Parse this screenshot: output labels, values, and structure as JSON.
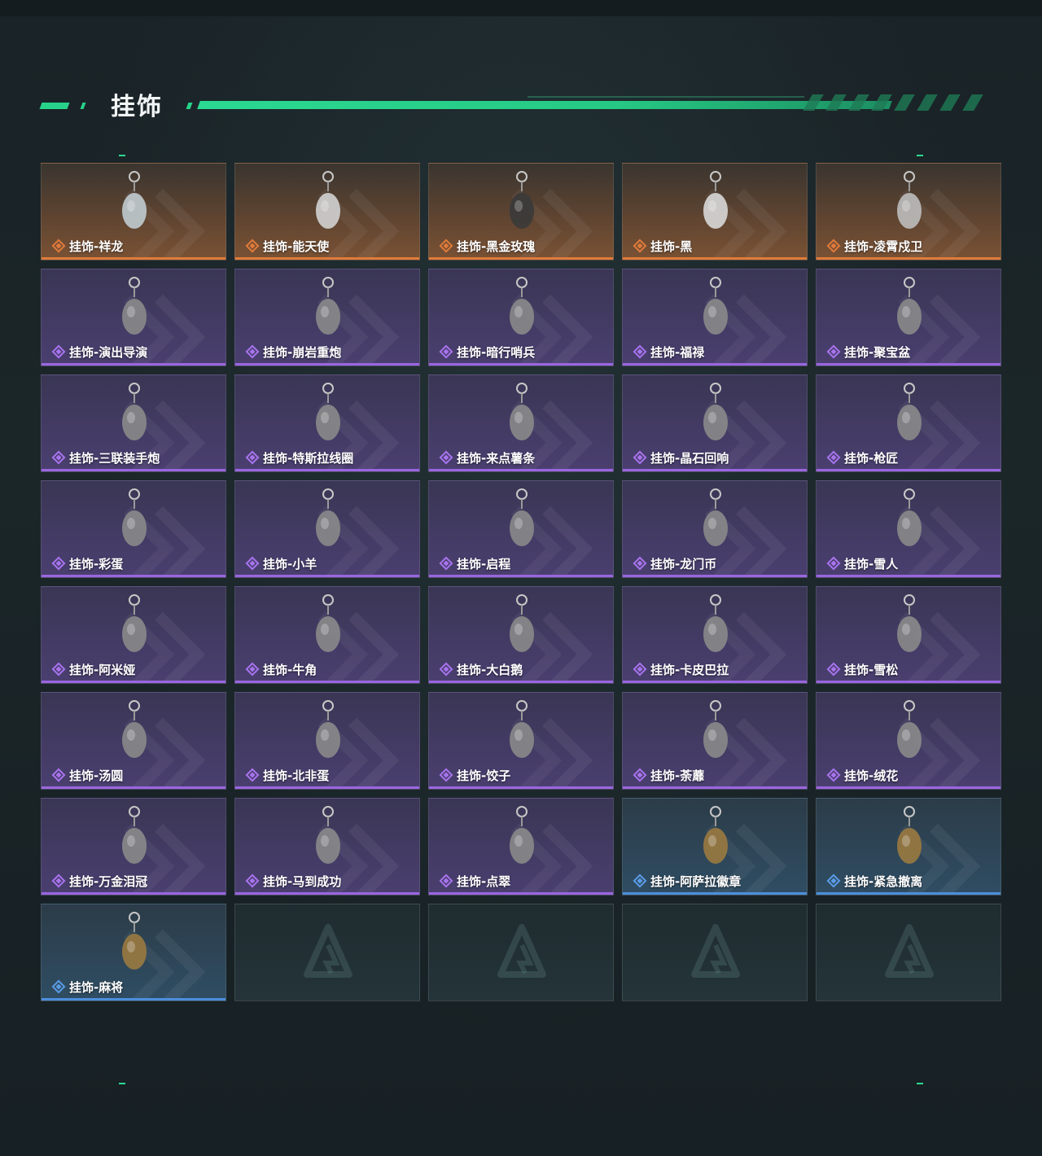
{
  "section": {
    "title": "挂饰"
  },
  "colors": {
    "accent": "#2bd992",
    "legendary": "#e07a3a",
    "epic": "#9a66e0",
    "rare": "#4c8fdc"
  },
  "items": [
    {
      "label": "挂饰-祥龙",
      "rarity": "orange",
      "icon": "dragon-charm-icon"
    },
    {
      "label": "挂饰-能天使",
      "rarity": "orange",
      "icon": "card-charm-icon"
    },
    {
      "label": "挂饰-黑金玫瑰",
      "rarity": "orange",
      "icon": "rose-charm-icon"
    },
    {
      "label": "挂饰-黑",
      "rarity": "orange",
      "icon": "card-charm-icon"
    },
    {
      "label": "挂饰-凌霄戍卫",
      "rarity": "orange",
      "icon": "guardian-charm-icon"
    },
    {
      "label": "挂饰-演出导演",
      "rarity": "purple",
      "icon": "figure-charm-icon"
    },
    {
      "label": "挂饰-崩岩重炮",
      "rarity": "purple",
      "icon": "figure-charm-icon"
    },
    {
      "label": "挂饰-暗行哨兵",
      "rarity": "purple",
      "icon": "soldier-charm-icon"
    },
    {
      "label": "挂饰-福禄",
      "rarity": "purple",
      "icon": "gourd-charm-icon"
    },
    {
      "label": "挂饰-聚宝盆",
      "rarity": "purple",
      "icon": "treasure-bowl-charm-icon"
    },
    {
      "label": "挂饰-三联装手炮",
      "rarity": "purple",
      "icon": "hand-cannon-charm-icon"
    },
    {
      "label": "挂饰-特斯拉线圈",
      "rarity": "purple",
      "icon": "tesla-coil-charm-icon"
    },
    {
      "label": "挂饰-来点薯条",
      "rarity": "purple",
      "icon": "fries-charm-icon"
    },
    {
      "label": "挂饰-晶石回响",
      "rarity": "purple",
      "icon": "crystal-charm-icon"
    },
    {
      "label": "挂饰-枪匠",
      "rarity": "purple",
      "icon": "gunsmith-charm-icon"
    },
    {
      "label": "挂饰-彩蛋",
      "rarity": "purple",
      "icon": "egg-charm-icon"
    },
    {
      "label": "挂饰-小羊",
      "rarity": "purple",
      "icon": "sheep-charm-icon"
    },
    {
      "label": "挂饰-启程",
      "rarity": "purple",
      "icon": "emblem-charm-icon"
    },
    {
      "label": "挂饰-龙门币",
      "rarity": "purple",
      "icon": "coin-charm-icon"
    },
    {
      "label": "挂饰-雪人",
      "rarity": "purple",
      "icon": "snowman-charm-icon"
    },
    {
      "label": "挂饰-阿米娅",
      "rarity": "purple",
      "icon": "rabbit-charm-icon"
    },
    {
      "label": "挂饰-牛角",
      "rarity": "purple",
      "icon": "horns-charm-icon"
    },
    {
      "label": "挂饰-大白鹅",
      "rarity": "purple",
      "icon": "goose-charm-icon"
    },
    {
      "label": "挂饰-卡皮巴拉",
      "rarity": "purple",
      "icon": "capybara-charm-icon"
    },
    {
      "label": "挂饰-雪松",
      "rarity": "purple",
      "icon": "tree-charm-icon"
    },
    {
      "label": "挂饰-汤圆",
      "rarity": "purple",
      "icon": "dumpling-bowl-charm-icon"
    },
    {
      "label": "挂饰-北非蛋",
      "rarity": "purple",
      "icon": "shakshuka-charm-icon"
    },
    {
      "label": "挂饰-饺子",
      "rarity": "purple",
      "icon": "jiaozi-charm-icon"
    },
    {
      "label": "挂饰-荼蘼",
      "rarity": "purple",
      "icon": "flower-charm-icon"
    },
    {
      "label": "挂饰-绒花",
      "rarity": "purple",
      "icon": "red-flower-charm-icon"
    },
    {
      "label": "挂饰-万金泪冠",
      "rarity": "purple",
      "icon": "crown-charm-icon"
    },
    {
      "label": "挂饰-马到成功",
      "rarity": "purple",
      "icon": "horse-charm-icon"
    },
    {
      "label": "挂饰-点翠",
      "rarity": "purple",
      "icon": "hairpin-charm-icon"
    },
    {
      "label": "挂饰-阿萨拉徽章",
      "rarity": "blue",
      "icon": "badge-charm-icon"
    },
    {
      "label": "挂饰-紧急撤离",
      "rarity": "blue",
      "icon": "skull-charm-icon"
    },
    {
      "label": "挂饰-麻将",
      "rarity": "blue",
      "icon": "mahjong-charm-icon"
    }
  ],
  "empty_slots": 4
}
